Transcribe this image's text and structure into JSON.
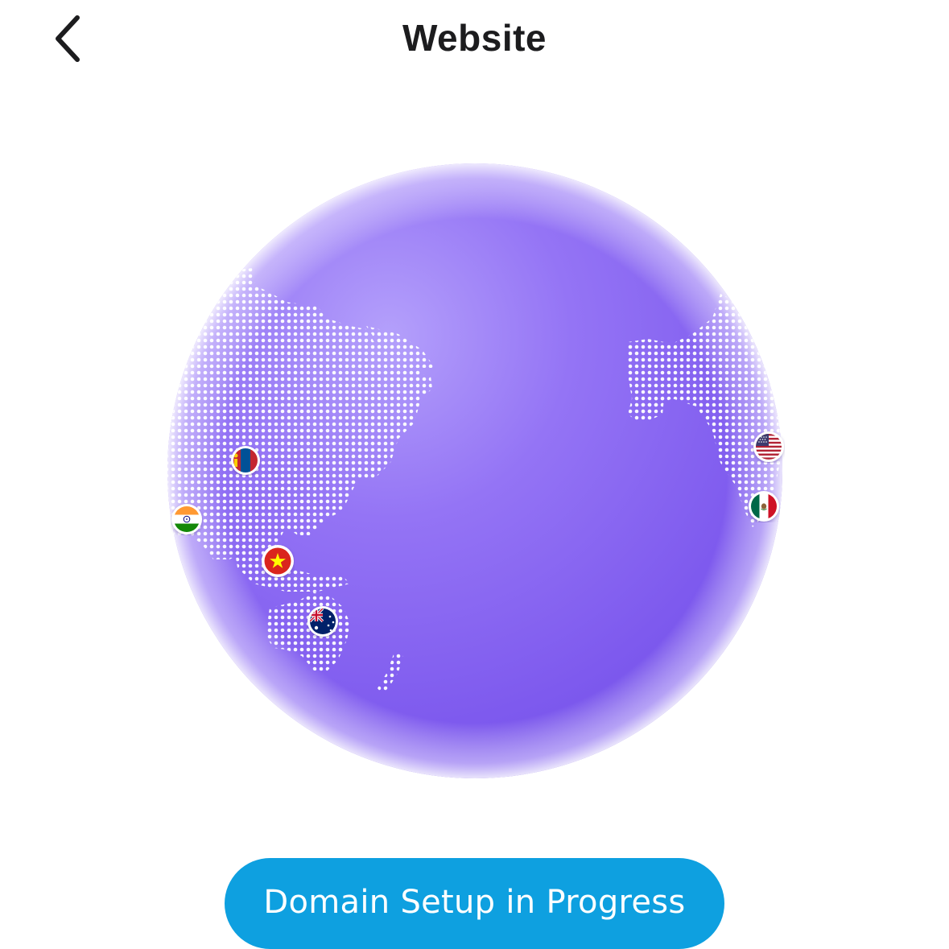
{
  "header": {
    "title": "Website",
    "back_icon": "chevron-left-icon"
  },
  "globe": {
    "icon": "globe-map-illustration",
    "base_color": "#8b6cf2",
    "highlight_color": "#b39cfb",
    "shadow_color": "#6f4fe6",
    "dot_color": "#ffffff",
    "flags": [
      {
        "country": "Mongolia",
        "icon": "mongolia-flag-icon"
      },
      {
        "country": "India",
        "icon": "india-flag-icon"
      },
      {
        "country": "Vietnam",
        "icon": "vietnam-flag-icon"
      },
      {
        "country": "Australia",
        "icon": "australia-flag-icon"
      },
      {
        "country": "United States",
        "icon": "usa-flag-icon"
      },
      {
        "country": "Mexico",
        "icon": "mexico-flag-icon"
      }
    ]
  },
  "status_button": {
    "label": "Domain Setup in Progress",
    "color": "#0ea0e0"
  }
}
